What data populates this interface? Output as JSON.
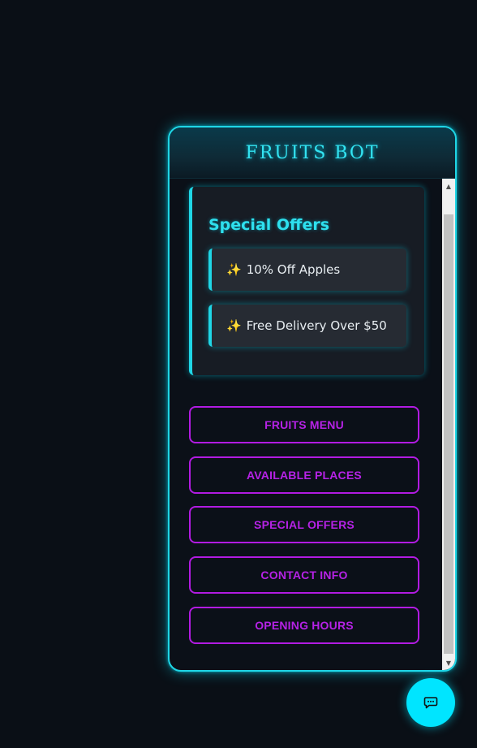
{
  "header": {
    "title": "FRUITS BOT"
  },
  "offers": {
    "title": "Special Offers",
    "items": [
      {
        "icon": "sparkles-icon",
        "text": "10% Off Apples"
      },
      {
        "icon": "sparkles-icon",
        "text": "Free Delivery Over $50"
      }
    ]
  },
  "menu": {
    "buttons": [
      {
        "label": "FRUITS MENU"
      },
      {
        "label": "AVAILABLE PLACES"
      },
      {
        "label": "SPECIAL OFFERS"
      },
      {
        "label": "CONTACT INFO"
      },
      {
        "label": "OPENING HOURS"
      }
    ]
  },
  "fab": {
    "icon": "chat-bubble-icon"
  },
  "colors": {
    "accent": "#00e5ff",
    "button": "#b622e6",
    "background": "#0a0f16"
  }
}
